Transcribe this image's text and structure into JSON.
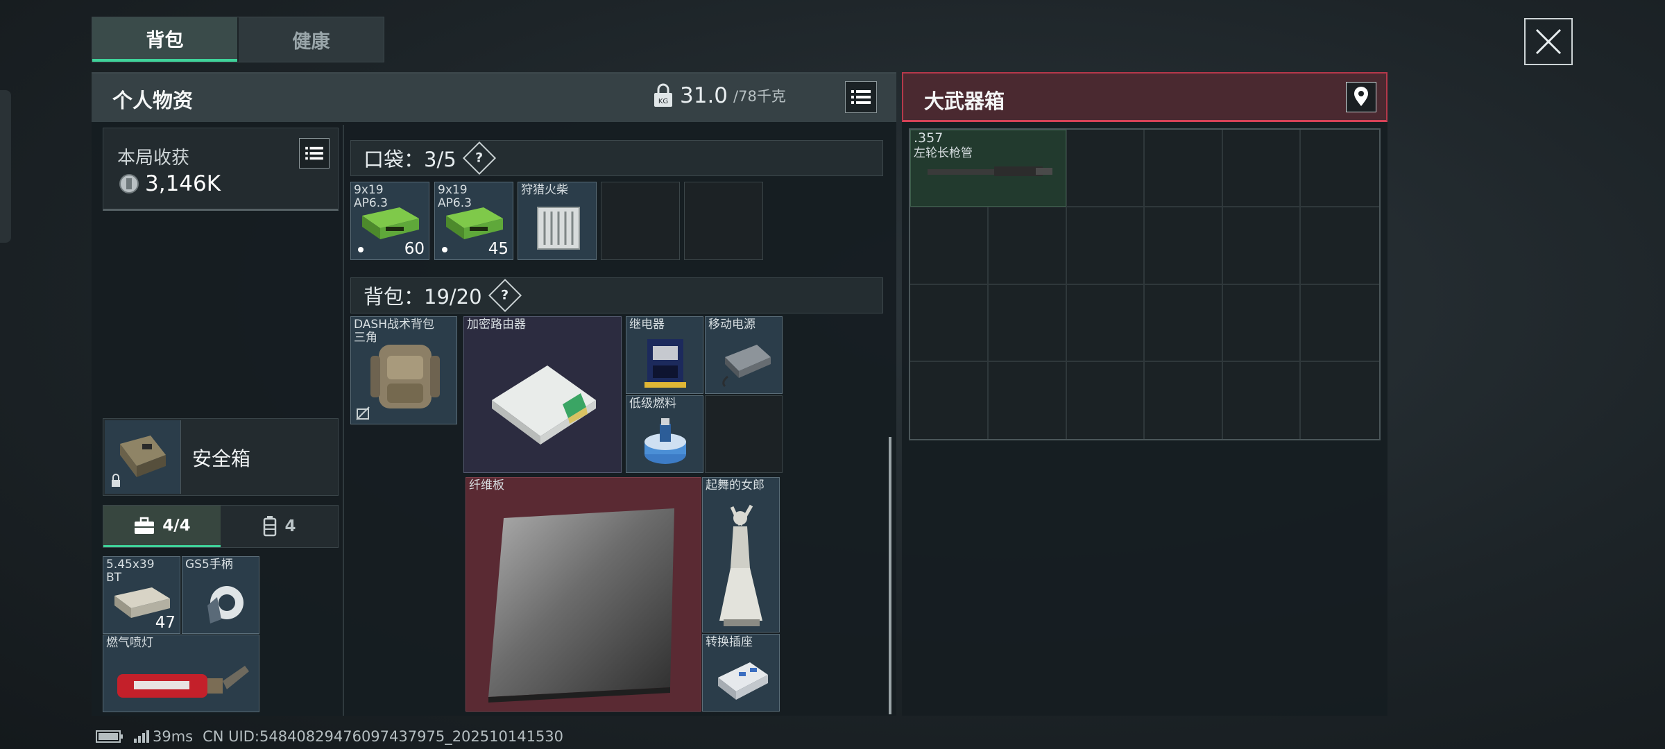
{
  "tabs": {
    "backpack": "背包",
    "health": "健康"
  },
  "personal": {
    "title": "个人物资",
    "weight_current": "31.0",
    "weight_max": "/78千克",
    "gain_label": "本局收获",
    "gain_value": "3,146K",
    "safe_label": "安全箱",
    "sub_tab_case": "4/4",
    "sub_tab_other": "4"
  },
  "pocket": {
    "label": "口袋：3/5",
    "items": [
      {
        "name": "9x19\nAP6.3",
        "qty": "60"
      },
      {
        "name": "9x19\nAP6.3",
        "qty": "45"
      },
      {
        "name": "狩猎火柴",
        "qty": ""
      }
    ]
  },
  "backpack": {
    "label": "背包：19/20",
    "items": {
      "dash": "DASH战术背包\n三角",
      "router": "加密路由器",
      "relay": "继电器",
      "power": "移动电源",
      "fuel": "低级燃料",
      "fiber": "纤维板",
      "dancer": "起舞的女郎",
      "socket": "转换插座"
    }
  },
  "case_items": {
    "ammo": {
      "name": "5.45x39\nBT",
      "qty": "47"
    },
    "gs5": "GS5手柄",
    "torch": "燃气喷灯"
  },
  "crate": {
    "title": "大武器箱",
    "item_caliber": ".357",
    "item_name": "左轮长枪管"
  },
  "footer": {
    "ping": "39ms",
    "uid": "CN UID:54840829476097437975_202510141530"
  }
}
